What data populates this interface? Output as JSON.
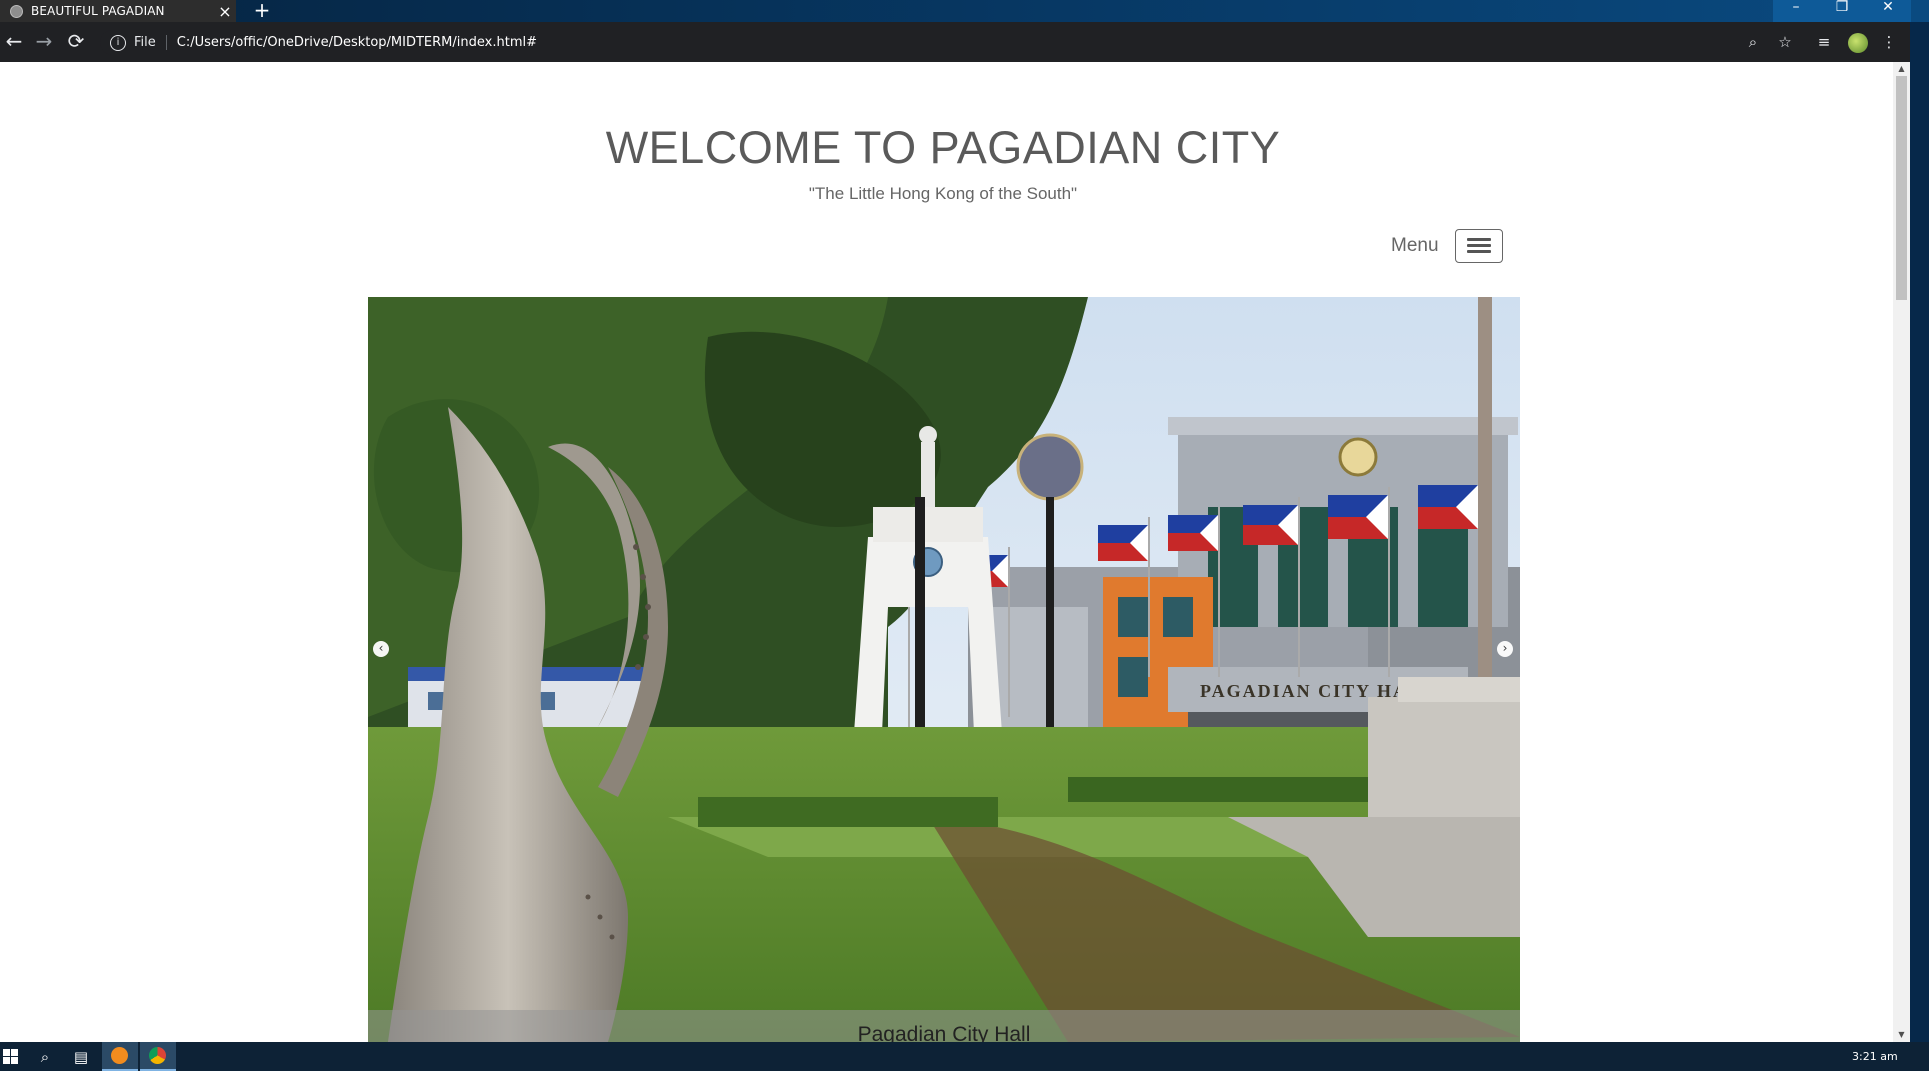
{
  "browser": {
    "tab_title": "BEAUTIFUL PAGADIAN",
    "tab_close": "×",
    "new_tab": "+",
    "scheme_label": "File",
    "url": "C:/Users/offic/OneDrive/Desktop/MIDTERM/index.html#",
    "back": "←",
    "forward": "→",
    "reload": "⟳",
    "info": "i",
    "zoom_icon": "⌕",
    "star_icon": "☆",
    "media_icon": "≡",
    "more_icon": "⋮",
    "minimize": "–",
    "maximize": "❐",
    "close": "✕"
  },
  "page": {
    "title": "WELCOME TO PAGADIAN CITY",
    "tagline": "\"The Little Hong Kong of the South\"",
    "menu_label": "Menu"
  },
  "carousel": {
    "caption": "Pagadian City Hall",
    "prev": "‹",
    "next": "›",
    "sign_text": "PAGADIAN CITY HALL"
  },
  "taskbar": {
    "start_icon": "windows-icon",
    "search_icon": "search-icon",
    "taskview_icon": "task-view-icon",
    "clock": "3:21 am"
  },
  "colors": {
    "title_gray": "#5a5a5a",
    "browser_dark": "#202124",
    "taskbar": "#0d2236"
  }
}
